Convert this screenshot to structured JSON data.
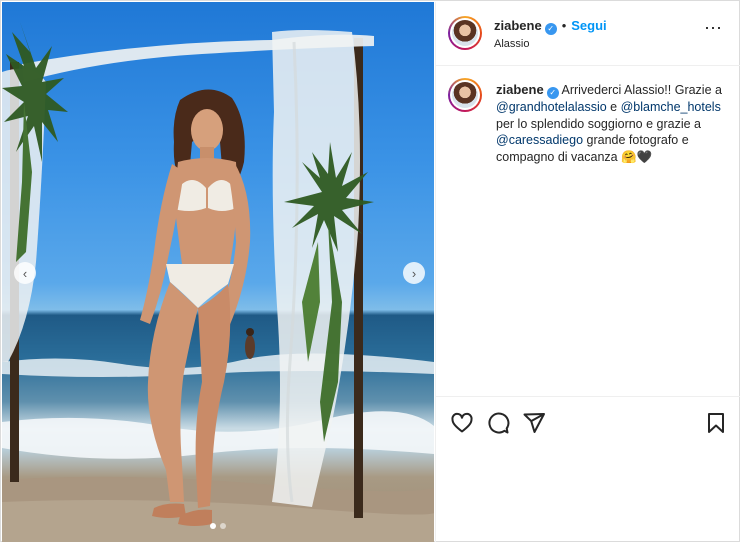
{
  "post": {
    "username": "ziabene",
    "verified": true,
    "separator": "•",
    "follow_label": "Segui",
    "location": "Alassio",
    "more_icon": "⋯"
  },
  "caption": {
    "username": "ziabene",
    "parts": [
      {
        "text": "Arrivederci Alassio!! Grazie a "
      },
      {
        "mention": "@grandhotelalassio"
      },
      {
        "text": " e "
      },
      {
        "mention": "@blamche_hotels"
      },
      {
        "text": " per lo splendido soggiorno e grazie a "
      },
      {
        "mention": "@caressadiego"
      },
      {
        "text": " grande fotografo e compagno di vacanza 🤗🖤"
      }
    ]
  },
  "carousel": {
    "prev_icon": "‹",
    "next_icon": "›",
    "current_slide": 1,
    "total_slides": 2
  },
  "actions": {
    "icons": [
      "heart-icon",
      "comment-icon",
      "share-icon",
      "bookmark-icon"
    ]
  },
  "colors": {
    "link": "#0095f6",
    "mention": "#00376b",
    "verified": "#3897f0"
  }
}
